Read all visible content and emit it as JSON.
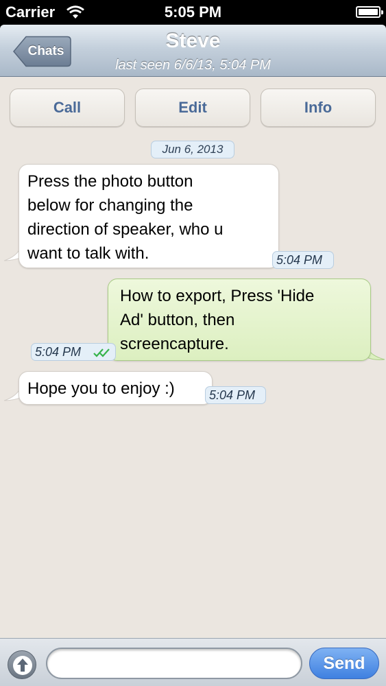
{
  "status_bar": {
    "carrier": "Carrier",
    "time": "5:05 PM"
  },
  "nav": {
    "back_label": "Chats",
    "title": "Steve",
    "subtitle": "last seen 6/6/13, 5:04 PM"
  },
  "actions": {
    "call": "Call",
    "edit": "Edit",
    "info": "Info"
  },
  "date_header": "Jun 6, 2013",
  "messages": [
    {
      "direction": "incoming",
      "lines": [
        "Press the photo button",
        "below for changing the",
        "direction of speaker, who u",
        "want to talk with."
      ],
      "time": "5:04 PM"
    },
    {
      "direction": "outgoing",
      "lines": [
        "How to export, Press 'Hide",
        "Ad' button, then",
        "screencapture."
      ],
      "time": "5:04 PM",
      "status": "read-double-check"
    },
    {
      "direction": "incoming",
      "lines": [
        "Hope you to enjoy :)"
      ],
      "time": "5:04 PM"
    }
  ],
  "input": {
    "placeholder": "",
    "send_label": "Send"
  },
  "icons": {
    "wifi": "wifi-icon",
    "battery": "battery-icon",
    "attach": "attach-arrow-icon",
    "read_status": "double-check-icon"
  },
  "colors": {
    "incoming_bubble": "#ffffff",
    "outgoing_bubble": "#dcefc0",
    "send_button": "#3f80e0",
    "check_mark": "#35b34a"
  }
}
